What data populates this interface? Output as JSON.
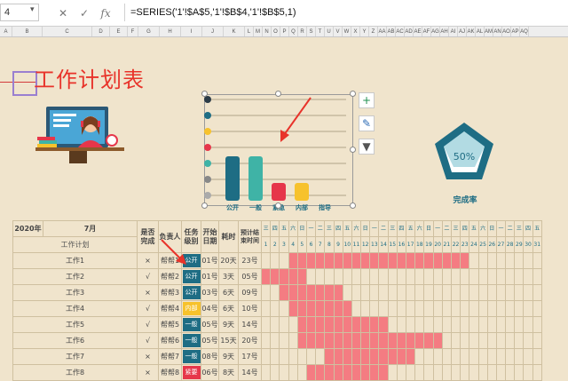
{
  "formula_bar": {
    "name_box": "4",
    "formula": "=SERIES('1'!$A$5,'1'!$B$4,'1'!$B$5,1)"
  },
  "column_letters": [
    "A",
    "B",
    "C",
    "D",
    "E",
    "F",
    "G",
    "H",
    "I",
    "J",
    "K",
    "L",
    "M",
    "N",
    "O",
    "P",
    "Q",
    "R",
    "S",
    "T",
    "U",
    "V",
    "W",
    "X",
    "Y",
    "Z",
    "AA",
    "AB",
    "AC",
    "AD",
    "AE",
    "AF",
    "AG",
    "AH",
    "AI",
    "AJ",
    "AK",
    "AL",
    "AM",
    "AN",
    "AO",
    "AP",
    "AQ"
  ],
  "title": "工作计划表",
  "chart_data": {
    "type": "bar",
    "categories": [
      "公开",
      "一般",
      "紧急",
      "内部",
      "指导"
    ],
    "values": [
      5,
      5,
      2,
      2,
      0
    ],
    "colors": [
      "#1e6d84",
      "#3fb3a6",
      "#e6364a",
      "#f7c22c",
      "#f7c22c"
    ]
  },
  "kpi": {
    "value": "50%",
    "label": "完成率"
  },
  "table": {
    "year": "2020年",
    "month": "7月",
    "headers": {
      "done": "是否完成",
      "owner": "负责人",
      "level": "任务级别",
      "start": "开始日期",
      "duration": "耗时",
      "end": "预计结束时间",
      "plan": "工作计划"
    },
    "weekdays": [
      "三",
      "四",
      "五",
      "六",
      "日",
      "一",
      "二",
      "三",
      "四",
      "五",
      "六",
      "日",
      "一",
      "二",
      "三",
      "四",
      "五",
      "六",
      "日",
      "一",
      "二",
      "三",
      "四",
      "五",
      "六",
      "日",
      "一",
      "二",
      "三",
      "四",
      "五"
    ],
    "days": [
      "1",
      "2",
      "3",
      "4",
      "5",
      "6",
      "7",
      "8",
      "9",
      "10",
      "11",
      "12",
      "13",
      "14",
      "15",
      "16",
      "17",
      "18",
      "19",
      "20",
      "21",
      "22",
      "23",
      "24",
      "25",
      "26",
      "27",
      "28",
      "29",
      "30",
      "31"
    ],
    "rows": [
      {
        "name": "工作1",
        "done": "×",
        "owner": "帮帮1",
        "level": "公开",
        "color": "#1e6d84",
        "start": "01号",
        "dur": "20天",
        "end": "23号",
        "s": 4,
        "e": 23
      },
      {
        "name": "工作2",
        "done": "√",
        "owner": "帮帮2",
        "level": "公开",
        "color": "#1e6d84",
        "start": "01号",
        "dur": "3天",
        "end": "05号",
        "s": 1,
        "e": 5
      },
      {
        "name": "工作3",
        "done": "×",
        "owner": "帮帮3",
        "level": "公开",
        "color": "#1e6d84",
        "start": "03号",
        "dur": "6天",
        "end": "09号",
        "s": 3,
        "e": 9
      },
      {
        "name": "工作4",
        "done": "√",
        "owner": "帮帮4",
        "level": "内部",
        "color": "#f7c22c",
        "start": "04号",
        "dur": "6天",
        "end": "10号",
        "s": 4,
        "e": 10
      },
      {
        "name": "工作5",
        "done": "√",
        "owner": "帮帮5",
        "level": "一般",
        "color": "#1e6d84",
        "start": "05号",
        "dur": "9天",
        "end": "14号",
        "s": 5,
        "e": 14
      },
      {
        "name": "工作6",
        "done": "√",
        "owner": "帮帮6",
        "level": "一般",
        "color": "#1e6d84",
        "start": "05号",
        "dur": "15天",
        "end": "20号",
        "s": 5,
        "e": 20
      },
      {
        "name": "工作7",
        "done": "×",
        "owner": "帮帮7",
        "level": "一般",
        "color": "#1e6d84",
        "start": "08号",
        "dur": "9天",
        "end": "17号",
        "s": 8,
        "e": 17
      },
      {
        "name": "工作8",
        "done": "×",
        "owner": "帮帮8",
        "level": "紧要",
        "color": "#e6364a",
        "start": "06号",
        "dur": "8天",
        "end": "14号",
        "s": 6,
        "e": 14
      }
    ]
  }
}
